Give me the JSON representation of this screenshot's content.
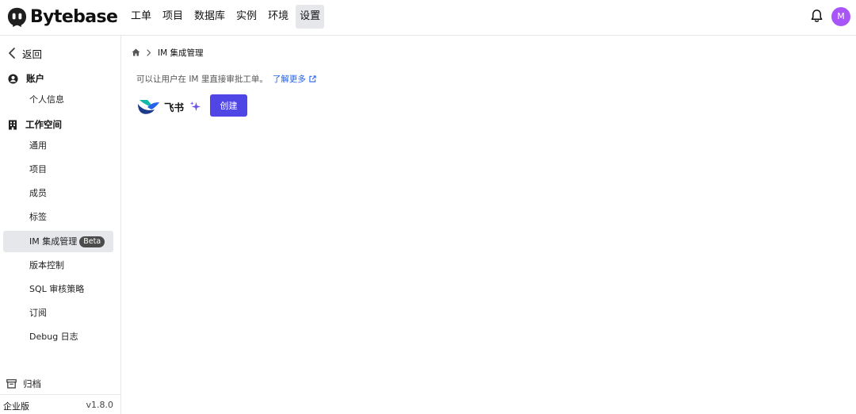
{
  "brand": {
    "name": "Bytebase"
  },
  "nav": {
    "items": [
      {
        "label": "工单"
      },
      {
        "label": "项目"
      },
      {
        "label": "数据库"
      },
      {
        "label": "实例"
      },
      {
        "label": "环境"
      },
      {
        "label": "设置",
        "active": true
      }
    ]
  },
  "user": {
    "avatar_initial": "M",
    "avatar_color": "#a855f7"
  },
  "sidebar": {
    "back_label": "返回",
    "account": {
      "label": "账户",
      "items": [
        {
          "label": "个人信息"
        }
      ]
    },
    "workspace": {
      "label": "工作空间",
      "items": [
        {
          "label": "通用"
        },
        {
          "label": "项目"
        },
        {
          "label": "成员"
        },
        {
          "label": "标签"
        },
        {
          "label": "IM 集成管理",
          "badge": "Beta",
          "active": true
        },
        {
          "label": "版本控制"
        },
        {
          "label": "SQL 审核策略"
        },
        {
          "label": "订阅"
        },
        {
          "label": "Debug 日志"
        }
      ]
    },
    "archive_label": "归档",
    "edition": "企业版",
    "version": "v1.8.0"
  },
  "main": {
    "breadcrumb": {
      "current": "IM 集成管理"
    },
    "description": "可以让用户在 IM 里直接审批工单。",
    "learn_more": "了解更多",
    "integration": {
      "name": "飞书",
      "create_label": "创建"
    },
    "accent_color": "#4f46e5",
    "link_color": "#2563eb"
  }
}
